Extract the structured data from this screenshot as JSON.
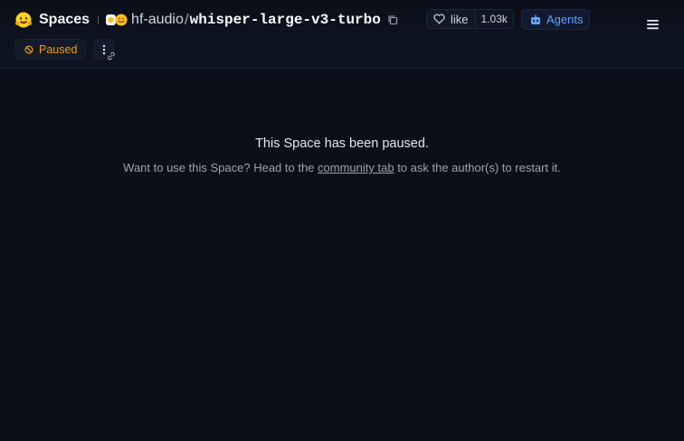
{
  "header": {
    "brand": "Spaces",
    "org": "hf-audio",
    "separator": "/",
    "space_name": "whisper-large-v3-turbo",
    "like_label": "like",
    "like_count": "1.03k",
    "agents_label": "Agents",
    "icons": {
      "logo": "huggingface-logo-icon",
      "org_avatar": "org-avatar-icon",
      "copy": "copy-icon",
      "like": "heart-icon",
      "agents": "robot-icon",
      "menu": "hamburger-menu-icon"
    }
  },
  "status": {
    "label": "Paused",
    "color": "#f59e0b",
    "icon": "paused-circle-icon",
    "more_icon": "vertical-dots-icon",
    "link_icon": "link-icon"
  },
  "message": {
    "title": "This Space has been paused.",
    "body_before": "Want to use this Space? Head to the ",
    "link_text": "community tab",
    "body_after": " to ask the author(s) to restart it."
  },
  "colors": {
    "background": "#0b0f19",
    "accent_blue": "#60a5fa",
    "paused_orange": "#f59e0b"
  }
}
